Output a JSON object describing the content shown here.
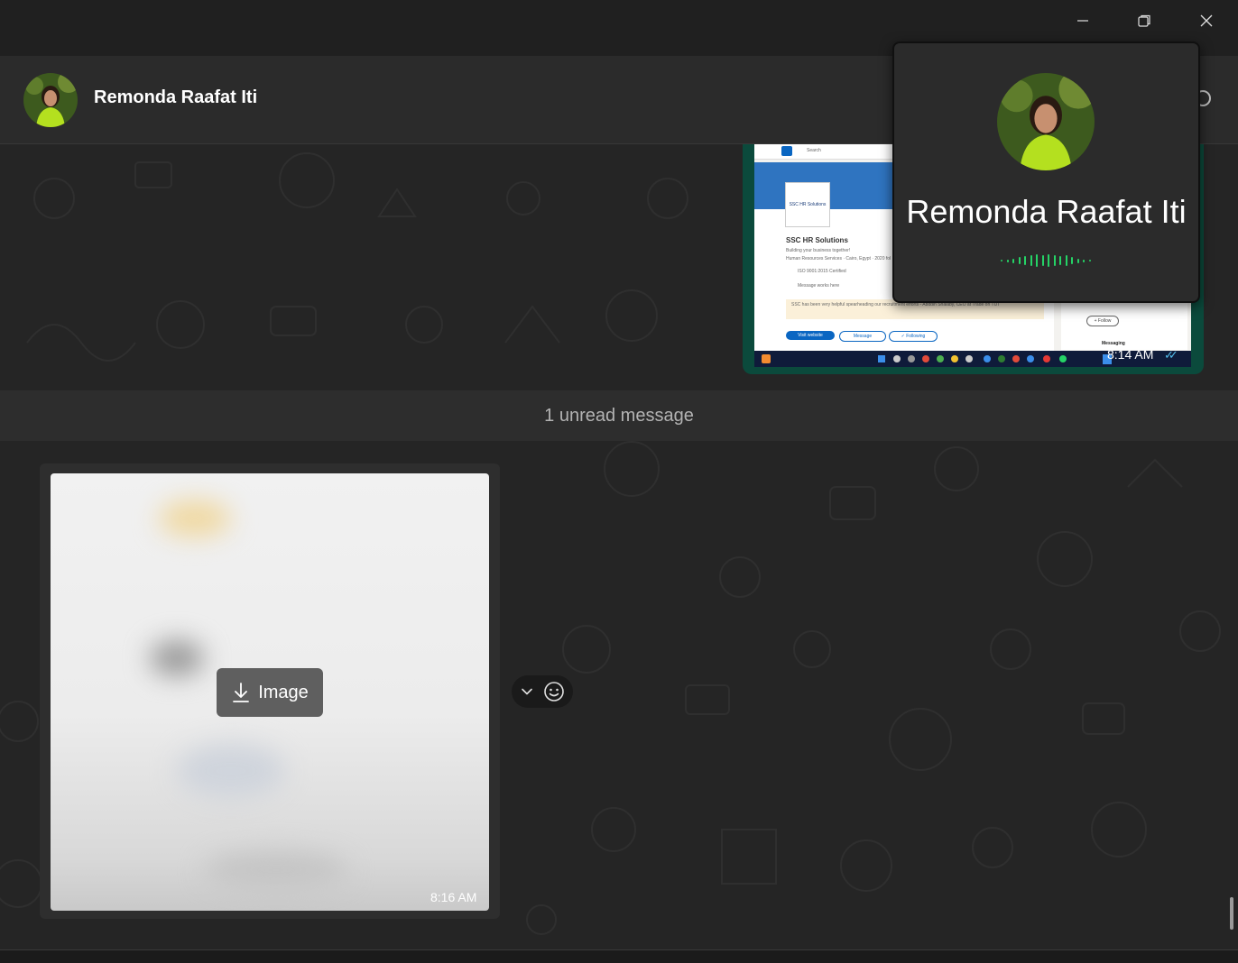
{
  "window": {
    "controls": {
      "minimize_icon": "minimize-icon",
      "restore_icon": "restore-icon",
      "close_icon": "close-icon"
    }
  },
  "header": {
    "contact_name": "Remonda Raafat Iti",
    "avatar_icon": "profile-photo"
  },
  "chat": {
    "outgoing_image": {
      "time": "8:14 AM",
      "status": "read",
      "thumbnail": {
        "company_name": "SSC HR Solutions",
        "tagline": "Building your business together!",
        "details": "Human Resources Services · Cairo, Egypt · 2020 fol",
        "cert": "ISO 9001:2015 Certified",
        "employee_note": "Message works here",
        "quote": "SSC has been very helpful spearheading our recruitment efforts - Abddin Shalaby, CEO at Trade on TUT",
        "visit_button": "Visit website",
        "message_button": "Message",
        "following_button": "✓ Following",
        "follow_button": "+ Follow",
        "messaging_label": "Messaging",
        "search_placeholder": "Search"
      }
    },
    "unread_separator": "1 unread message",
    "incoming_image": {
      "time": "8:16 AM",
      "download_label": "Image"
    },
    "reaction_controls": {
      "chevron_icon": "chevron-down-icon",
      "emoji_icon": "emoji-icon"
    }
  },
  "call_popup": {
    "caller_name": "Remonda Raafat Iti",
    "accent": "#25d366"
  },
  "colors": {
    "background": "#252525",
    "header": "#2b2b2b",
    "outgoing_bubble": "#0b4a3c",
    "incoming_bubble": "#2e2e2e",
    "read_ticks": "#53bdeb"
  }
}
